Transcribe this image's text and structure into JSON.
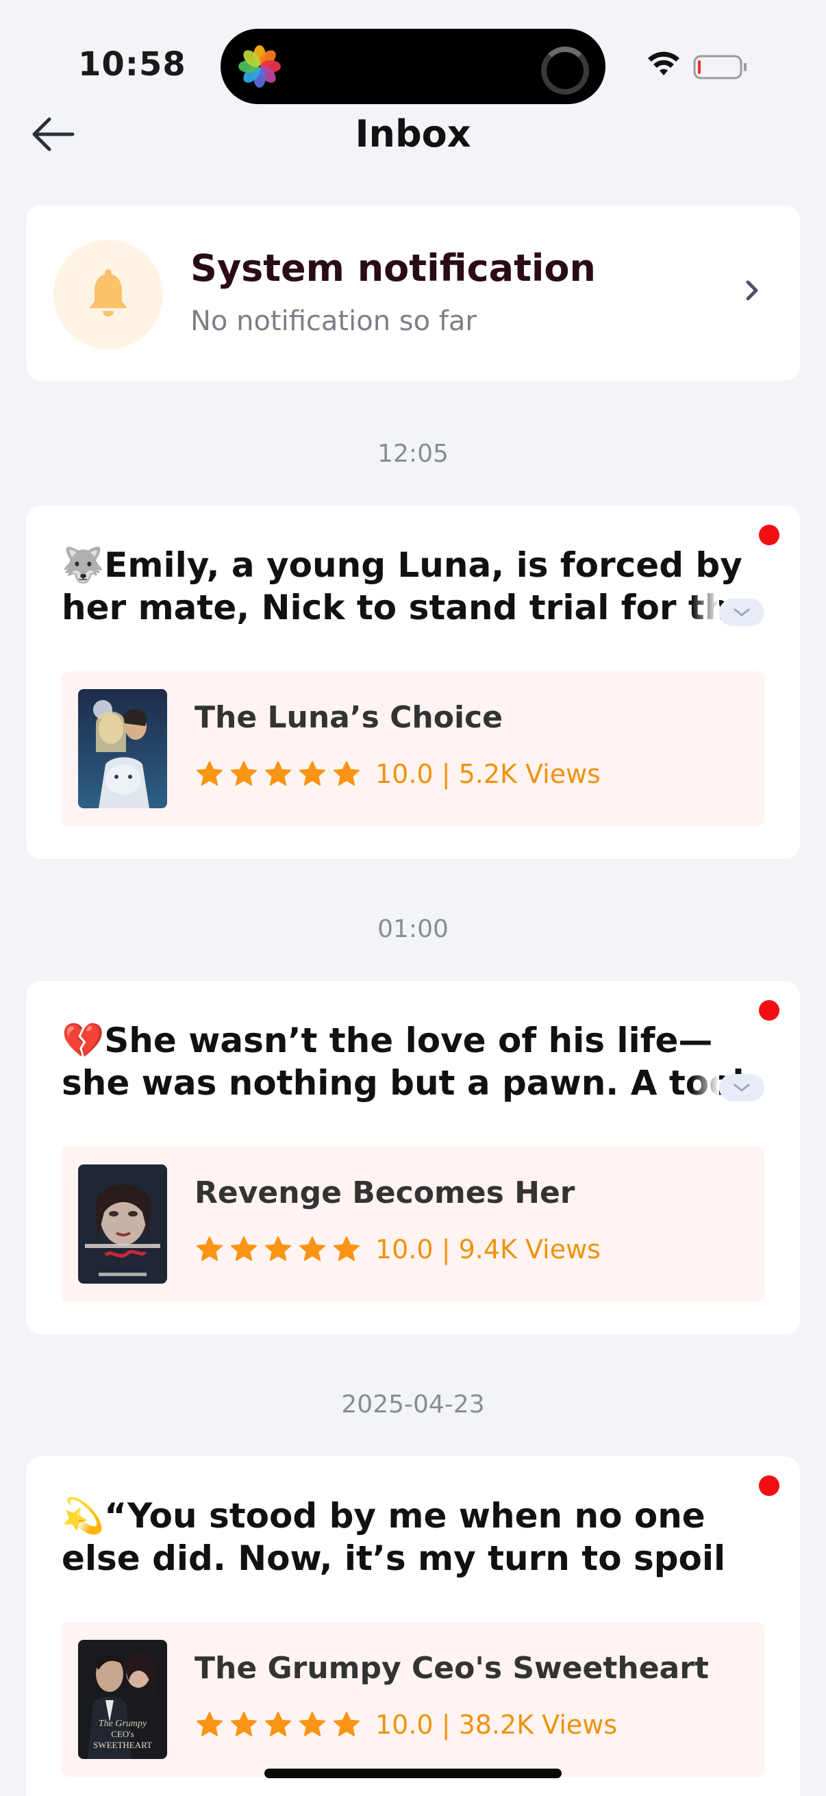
{
  "status_bar": {
    "time": "10:58"
  },
  "header": {
    "title": "Inbox"
  },
  "system_notification": {
    "title": "System notification",
    "subtitle": "No notification so far"
  },
  "messages": [
    {
      "timestamp": "12:05",
      "emoji": "🐺",
      "text": "Emily, a young Luna, is forced by her mate, Nick  to stand trial for the mur",
      "book": {
        "title": "The Luna’s Choice",
        "rating": "10.0",
        "separator": " | ",
        "views": "5.2K Views"
      },
      "unread": true
    },
    {
      "timestamp": "01:00",
      "emoji": "💔",
      "text": "She wasn’t the love of his life—she was nothing but a pawn.  A tool for re",
      "book": {
        "title": "Revenge Becomes Her",
        "rating": "10.0",
        "separator": " | ",
        "views": "9.4K Views"
      },
      "unread": true
    },
    {
      "timestamp": "2025-04-23",
      "emoji": "💫",
      "text": "“You stood by me when no one else did.  Now, it’s my turn to spoil you.”",
      "book": {
        "title": "The Grumpy Ceo's Sweetheart",
        "rating": "10.0",
        "separator": " | ",
        "views": "38.2K Views"
      },
      "unread": true
    }
  ],
  "colors": {
    "accent": "#f0920f",
    "unread_dot": "#f20f14",
    "background": "#f3f4f8"
  }
}
